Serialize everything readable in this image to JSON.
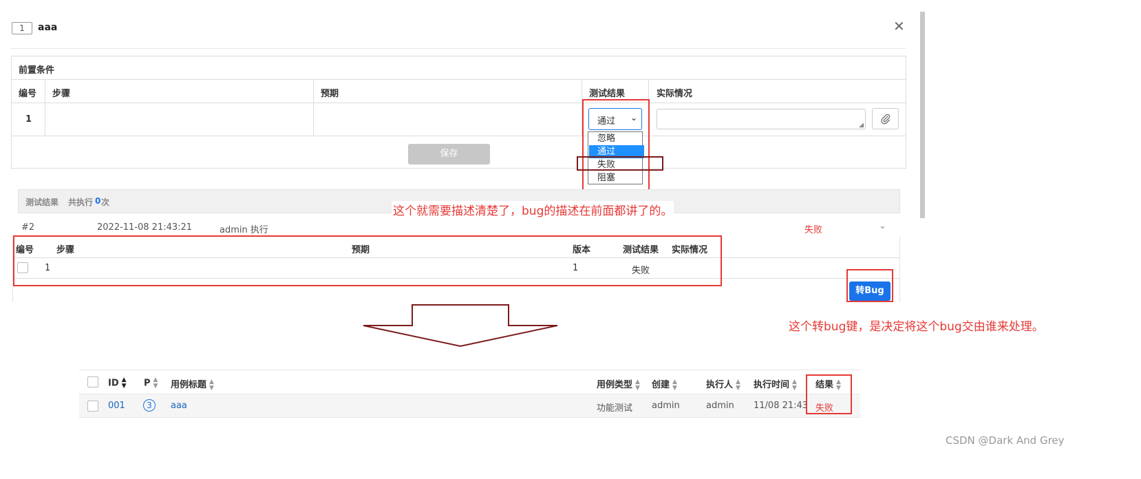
{
  "dialog": {
    "case_id": "1",
    "case_title": "aaa",
    "close_symbol": "✕"
  },
  "steps_table": {
    "precondition_label": "前置条件",
    "headers": [
      "编号",
      "步骤",
      "预期",
      "测试结果",
      "实际情况"
    ],
    "row": {
      "no": "1",
      "step": "",
      "expect": "",
      "result_selected": "通过",
      "actual": ""
    },
    "result_options": [
      "忽略",
      "通过",
      "失败",
      "阻塞"
    ],
    "highlighted_option": "通过",
    "save_label": "保存",
    "attach_icon": "paperclip-icon"
  },
  "results_section": {
    "title_prefix": "测试结果",
    "total_prefix": "共执行",
    "count": "0",
    "count_suffix": "次",
    "run": {
      "id": "#2",
      "time": "2022-11-08 21:43:21",
      "executor": "admin 执行",
      "status": "失败"
    },
    "headers": [
      "编号",
      "步骤",
      "预期",
      "版本",
      "测试结果",
      "实际情况"
    ],
    "row": {
      "no": "1",
      "step": "",
      "expect": "",
      "version": "1",
      "result": "失败",
      "actual": ""
    },
    "to_bug_label": "转Bug"
  },
  "annotations": {
    "note1": "这个就需要描述清楚了，bug的描述在前面都讲了的。",
    "note2": "这个转bug键，是决定将这个bug交由谁来处理。"
  },
  "case_list": {
    "headers": [
      "ID",
      "P",
      "用例标题",
      "用例类型",
      "创建",
      "执行人",
      "执行时间",
      "结果"
    ],
    "row": {
      "id": "001",
      "priority": "3",
      "title": "aaa",
      "type": "功能测试",
      "creator": "admin",
      "executor": "admin",
      "exec_time": "11/08 21:43",
      "result": "失败"
    }
  },
  "watermark": "CSDN @Dark And Grey",
  "colors": {
    "annotation_red": "#e53935",
    "dark_red": "#7b1a1a",
    "primary_blue": "#1a73e8",
    "link_blue": "#1565c0",
    "fail_red": "#e53935"
  }
}
